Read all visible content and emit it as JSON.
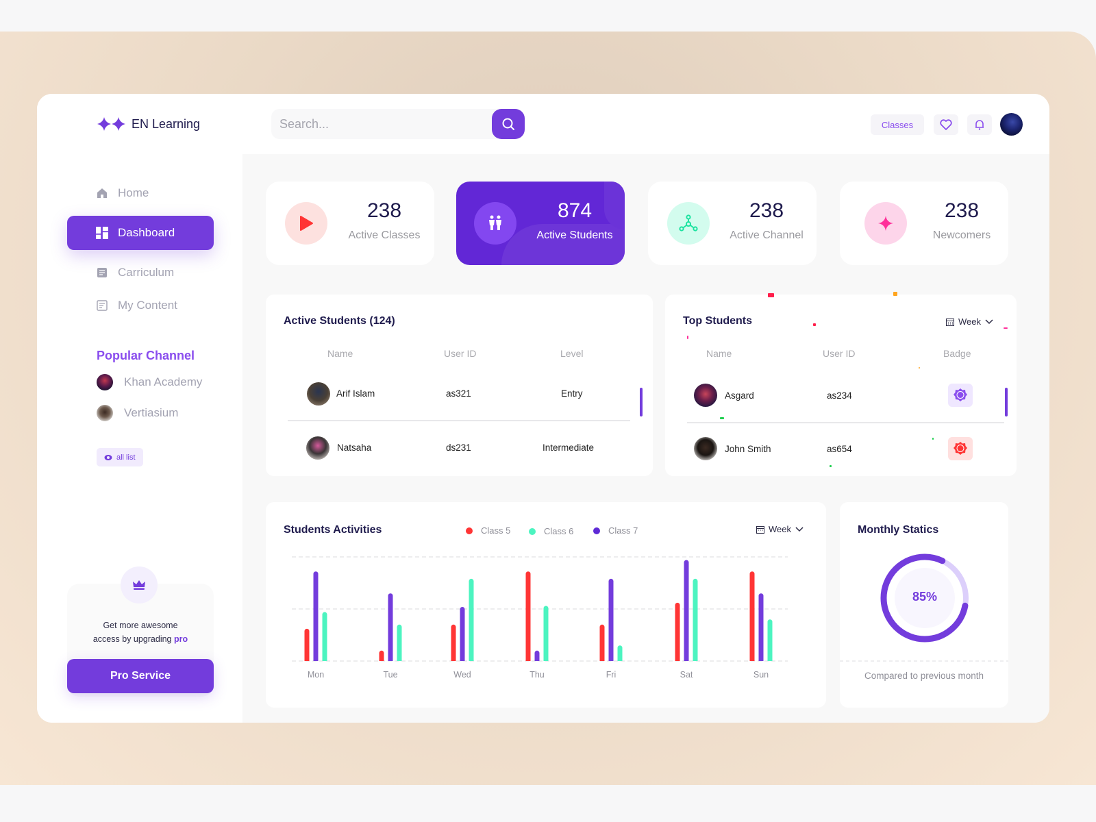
{
  "brand": {
    "name": "EN Learning",
    "accent": "#733cdc"
  },
  "search": {
    "placeholder": "Search..."
  },
  "topbar": {
    "classes_label": "Classes"
  },
  "sidebar": {
    "nav": [
      {
        "label": "Home",
        "icon": "home-icon",
        "active": false
      },
      {
        "label": "Dashboard",
        "icon": "dashboard-icon",
        "active": true
      },
      {
        "label": "Carriculum",
        "icon": "curriculum-icon",
        "active": false
      },
      {
        "label": "My Content",
        "icon": "content-icon",
        "active": false
      }
    ],
    "popular_title": "Popular Channel",
    "channels": [
      {
        "label": "Khan Academy"
      },
      {
        "label": "Vertiasium"
      }
    ],
    "all_list_label": "all list",
    "promo": {
      "line1": "Get more awesome",
      "line2": "access by upgrading",
      "highlight": "pro",
      "button_label": "Pro Service"
    }
  },
  "stats": [
    {
      "value": "238",
      "label": "Active Classes",
      "icon": "play-icon",
      "circle_color": "#fde1df",
      "icon_color": "#ff3535"
    },
    {
      "value": "874",
      "label": "Active Students",
      "icon": "students-icon",
      "circle_color": "#8347f0",
      "icon_color": "#ffffff"
    },
    {
      "value": "238",
      "label": "Active Channel",
      "icon": "channel-icon",
      "circle_color": "#d3fcee",
      "icon_color": "#1de3a0"
    },
    {
      "value": "238",
      "label": "Newcomers",
      "icon": "sparkle-icon",
      "circle_color": "#fdd5ea",
      "icon_color": "#ff2f9a"
    }
  ],
  "active_students": {
    "title": "Active Students (124)",
    "columns": [
      "Name",
      "User ID",
      "Level"
    ],
    "rows": [
      {
        "name": "Arif Islam",
        "user_id": "as321",
        "level": "Entry"
      },
      {
        "name": "Natsaha",
        "user_id": "ds231",
        "level": "Intermediate"
      }
    ]
  },
  "top_students": {
    "title": "Top Students",
    "period": "Week",
    "columns": [
      "Name",
      "User ID",
      "Badge"
    ],
    "rows": [
      {
        "name": "Asgard",
        "user_id": "as234",
        "badge": "behance-badge"
      },
      {
        "name": "John Smith",
        "user_id": "as654",
        "badge": "dribbble-badge"
      }
    ]
  },
  "activities": {
    "title": "Students Activities",
    "period": "Week"
  },
  "chart_data": {
    "type": "bar",
    "title": "Students Activities",
    "categories": [
      "Mon",
      "Tue",
      "Wed",
      "Thu",
      "Fri",
      "Sat",
      "Sun"
    ],
    "series": [
      {
        "name": "Class 5",
        "color": "#ff3535",
        "values": [
          31,
          10,
          35,
          86,
          35,
          56,
          86
        ]
      },
      {
        "name": "Class 7",
        "color": "#733cdc",
        "values": [
          86,
          65,
          52,
          10,
          79,
          97,
          65
        ]
      },
      {
        "name": "Class 6",
        "color": "#4cf4c0",
        "values": [
          47,
          35,
          79,
          53,
          15,
          79,
          40
        ]
      }
    ],
    "legend_order": [
      "Class 5",
      "Class 6",
      "Class 7"
    ],
    "legend_placement": "top",
    "ylim": [
      0,
      100
    ],
    "grid": true,
    "xlabel": "",
    "ylabel": ""
  },
  "monthly": {
    "title": "Monthly Statics",
    "percent": 85,
    "percent_label": "85%",
    "caption": "Compared to previous month"
  }
}
